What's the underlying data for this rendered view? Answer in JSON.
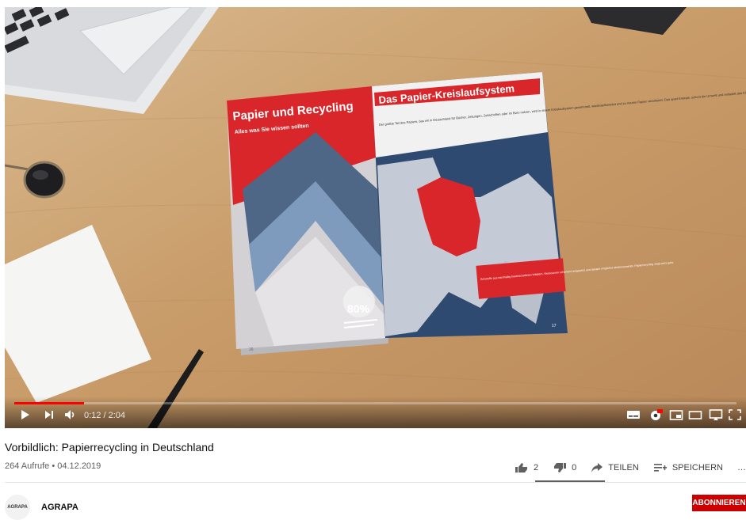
{
  "player": {
    "time_current": "0:12",
    "time_total": "2:04",
    "time_display": "0:12 / 2:04",
    "progress": 0.097,
    "icons": [
      "play-icon",
      "next-icon",
      "volume-icon",
      "subtitles-icon",
      "settings-icon",
      "miniplayer-icon",
      "theater-icon",
      "cast-icon",
      "fullscreen-icon"
    ],
    "hd_badge": "HD"
  },
  "brochure": {
    "left_title": "Papier und Recycling",
    "left_subtitle": "Alles was Sie wissen sollten",
    "left_percent": "80%",
    "left_page_number": "16",
    "right_title": "Das Papier-Kreislaufsystem",
    "right_body": "Der größte Teil des Papiers, das wir in Deutschland für Bücher, Zeitungen, Zeitschriften oder im Büro nutzen, wird in einem Kreislaufsystem gesammelt, wiederaufbereitet und zu neuem Papier verarbeitet. Das spart Energie, schont die Umwelt und entlastet das Klima.",
    "right_callout": "Rohstoffe aus nachhaltig bewirtschafteten Wäldern, Ressourcen schonend eingesetzt und danach möglichst wiederverwertet. Papierrecycling zeigt wie's geht.",
    "right_page_number": "17"
  },
  "video": {
    "title": "Vorbildlich: Papierrecycling in Deutschland",
    "meta": "264 Aufrufe • 04.12.2019"
  },
  "actions": {
    "likes": "2",
    "dislikes": "0",
    "share_label": "TEILEN",
    "save_label": "SPEICHERN",
    "more_label": "…"
  },
  "channel": {
    "avatar_text": "AGRAPA",
    "name": "AGRAPA",
    "subscribe_label": "ABONNIEREN"
  },
  "colors": {
    "accent_red": "#cc0000",
    "progress_red": "#ff0000",
    "brochure_red": "#d8262a",
    "map_sea": "#2f4a70",
    "map_land": "#c5cbd6"
  }
}
